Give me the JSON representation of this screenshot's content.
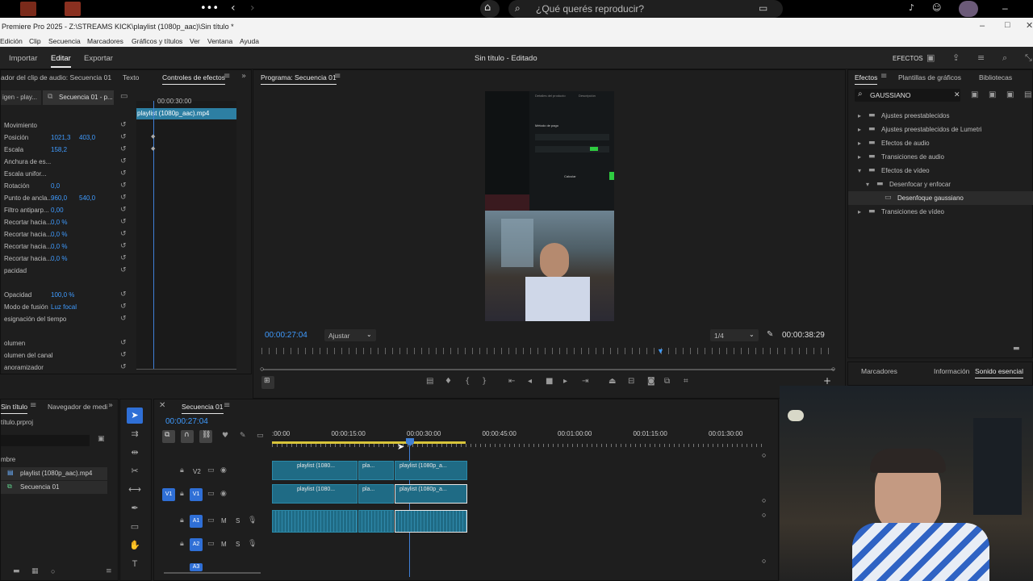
{
  "spotify": {
    "search_placeholder": "¿Qué querés reproducir?"
  },
  "window": {
    "title": "Premiere Pro 2025 - Z:\\STREAMS KICK\\playlist (1080p_aac)\\Sin título *"
  },
  "menu": [
    "Edición",
    "Clip",
    "Secuencia",
    "Marcadores",
    "Gráficos y títulos",
    "Ver",
    "Ventana",
    "Ayuda"
  ],
  "workspace": {
    "tabs": [
      "Importar",
      "Editar",
      "Exportar"
    ],
    "project_title": "Sin título - Editado",
    "effects_label": "EFECTOS"
  },
  "effect_controls": {
    "tabs": [
      "ador del clip de audio: Secuencia 01",
      "Texto",
      "Controles de efectos"
    ],
    "source": "igen - play...",
    "sequence": "Secuencia 01 - p...",
    "ruler_time": "00:00:30:00",
    "clip_name": "playlist (1080p_aac).mp4",
    "rows": [
      {
        "label": "Movimiento",
        "v1": "",
        "v2": ""
      },
      {
        "label": "Posición",
        "v1": "1021,3",
        "v2": "403,0"
      },
      {
        "label": "Escala",
        "v1": "158,2",
        "v2": ""
      },
      {
        "label": "Anchura de es...",
        "v1": "",
        "v2": ""
      },
      {
        "label": "Escala unifor...",
        "v1": "",
        "v2": ""
      },
      {
        "label": "Rotación",
        "v1": "0,0",
        "v2": ""
      },
      {
        "label": "Punto de ancla...",
        "v1": "960,0",
        "v2": "540,0"
      },
      {
        "label": "Filtro antiparp...",
        "v1": "0,00",
        "v2": ""
      },
      {
        "label": "Recortar hacia...",
        "v1": "0,0 %",
        "v2": ""
      },
      {
        "label": "Recortar hacia...",
        "v1": "0,0 %",
        "v2": ""
      },
      {
        "label": "Recortar hacia...",
        "v1": "0,0 %",
        "v2": ""
      },
      {
        "label": "Recortar hacia...",
        "v1": "0,0 %",
        "v2": ""
      },
      {
        "label": "pacidad",
        "v1": "",
        "v2": ""
      },
      {
        "label": "",
        "v1": "",
        "v2": ""
      },
      {
        "label": "Opacidad",
        "v1": "100,0 %",
        "v2": ""
      },
      {
        "label": "Modo de fusión",
        "v1": "Luz focal",
        "v2": ""
      },
      {
        "label": "esignación del tiempo",
        "v1": "",
        "v2": ""
      },
      {
        "label": "",
        "v1": "",
        "v2": ""
      },
      {
        "label": "olumen",
        "v1": "",
        "v2": ""
      },
      {
        "label": "olumen del canal",
        "v1": "",
        "v2": ""
      },
      {
        "label": "anoramizador",
        "v1": "",
        "v2": ""
      }
    ],
    "time": "0"
  },
  "program": {
    "title": "Programa: Secuencia 01",
    "timecode": "00:00:27:04",
    "fit": "Ajustar",
    "quality": "1/4",
    "duration": "00:00:38:29",
    "preview_text": [
      "Detalles del producto",
      "Descripción",
      "Método de pago",
      "Calcular"
    ]
  },
  "effects_panel": {
    "tabs": [
      "Efectos",
      "Plantillas de gráficos",
      "Bibliotecas"
    ],
    "search": "GAUSSIANO",
    "tree": [
      {
        "label": "Ajustes preestablecidos",
        "level": 0,
        "open": false
      },
      {
        "label": "Ajustes preestablecidos de Lumetri",
        "level": 0,
        "open": false
      },
      {
        "label": "Efectos de audio",
        "level": 0,
        "open": false
      },
      {
        "label": "Transiciones de audio",
        "level": 0,
        "open": false
      },
      {
        "label": "Efectos de vídeo",
        "level": 0,
        "open": true
      },
      {
        "label": "Desenfocar y enfocar",
        "level": 1,
        "open": true
      },
      {
        "label": "Desenfoque gaussiano",
        "level": 2,
        "open": false
      },
      {
        "label": "Transiciones de vídeo",
        "level": 0,
        "open": false
      }
    ],
    "bottom_tabs": [
      "Marcadores",
      "Información",
      "Sonido esencial"
    ]
  },
  "project": {
    "tabs": [
      "Sin título",
      "Navegador de medi"
    ],
    "file": "título.prproj",
    "name_header": "mbre",
    "items": [
      "playlist (1080p_aac).mp4",
      "Secuencia 01"
    ]
  },
  "timeline": {
    "tab": "Secuencia 01",
    "timecode": "00:00:27:04",
    "ruler": [
      ":00:00",
      "00:00:15:00",
      "00:00:30:00",
      "00:00:45:00",
      "00:01:00:00",
      "00:01:15:00",
      "00:01:30:00"
    ],
    "tracks": [
      "V2",
      "V1",
      "A1",
      "A2",
      "A3"
    ],
    "clip_labels": [
      "playlist (1080...",
      "pla...",
      "playlist (1080p_a..."
    ]
  }
}
